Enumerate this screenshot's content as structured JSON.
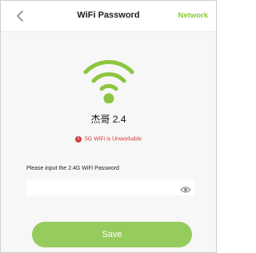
{
  "header": {
    "title": "WiFi Password",
    "network_label": "Network"
  },
  "network": {
    "ssid": "杰哥 2.4",
    "warning": "5G WiFi is Unworkable"
  },
  "password": {
    "label": "Please input the 2.4G WiFi Password",
    "value": "",
    "placeholder": ""
  },
  "actions": {
    "save_label": "Save"
  },
  "colors": {
    "accent": "#8cc63f",
    "button": "#96cc5e",
    "warning": "#d23c3c"
  },
  "icons": {
    "back": "chevron-left-icon",
    "wifi": "wifi-icon",
    "warning": "exclamation-icon",
    "eye": "eye-icon"
  }
}
